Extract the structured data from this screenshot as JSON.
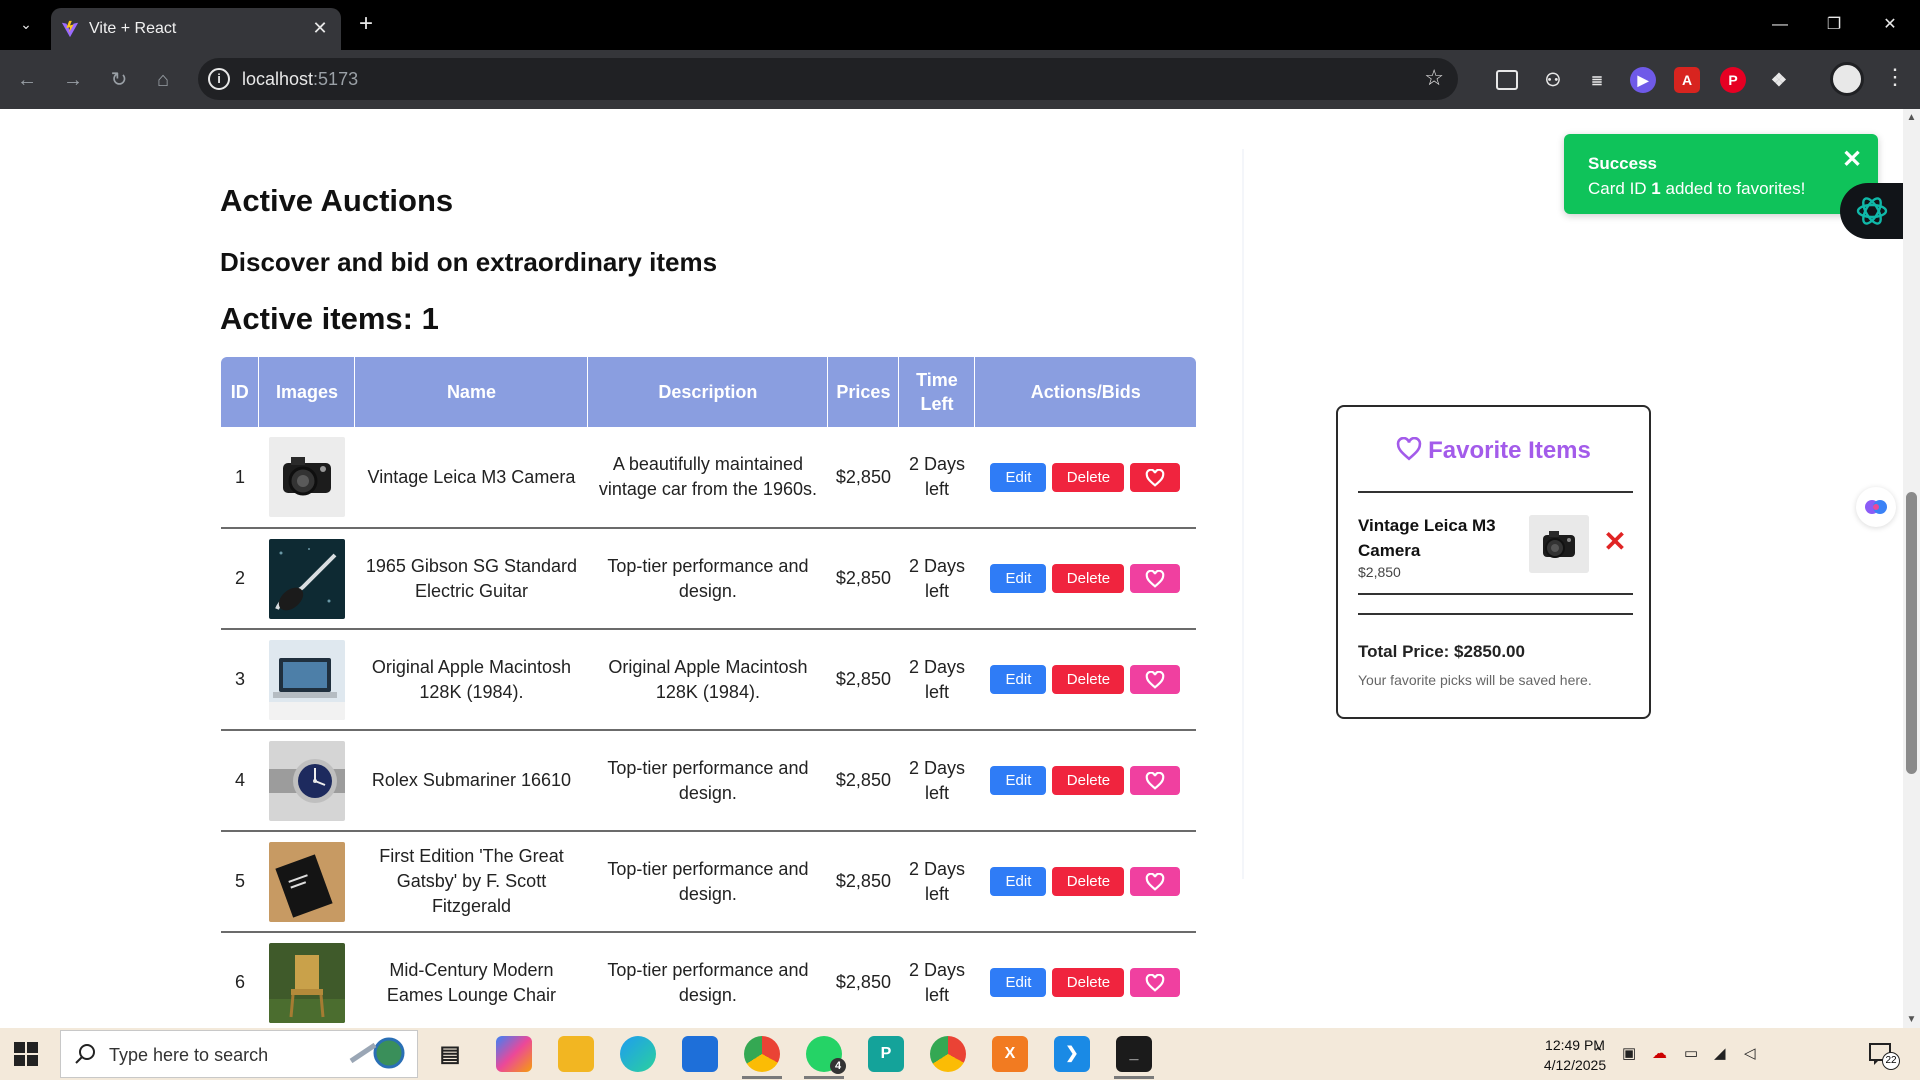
{
  "browser": {
    "tab_title": "Vite + React",
    "url_host": "localhost",
    "url_port": ":5173"
  },
  "page": {
    "title": "Active Auctions",
    "subtitle": "Discover and bid on extraordinary items",
    "active_items": "Active items: 1"
  },
  "table": {
    "headers": [
      "ID",
      "Images",
      "Name",
      "Description",
      "Prices",
      "Time Left",
      "Actions/Bids"
    ],
    "edit_label": "Edit",
    "delete_label": "Delete",
    "rows": [
      {
        "id": "1",
        "image": "camera",
        "name": "Vintage Leica M3 Camera",
        "description": "A beautifully maintained vintage car from the 1960s.",
        "price": "$2,850",
        "time_left": "2 Days left",
        "favorited": true
      },
      {
        "id": "2",
        "image": "guitar",
        "name": "1965 Gibson SG Standard Electric Guitar",
        "description": "Top-tier performance and design.",
        "price": "$2,850",
        "time_left": "2 Days left",
        "favorited": false
      },
      {
        "id": "3",
        "image": "laptop",
        "name": "Original Apple Macintosh 128K (1984).",
        "description": "Original Apple Macintosh 128K (1984).",
        "price": "$2,850",
        "time_left": "2 Days left",
        "favorited": false
      },
      {
        "id": "4",
        "image": "watch",
        "name": "Rolex Submariner 16610",
        "description": "Top-tier performance and design.",
        "price": "$2,850",
        "time_left": "2 Days left",
        "favorited": false
      },
      {
        "id": "5",
        "image": "book",
        "name": "First Edition 'The Great Gatsby' by F. Scott Fitzgerald",
        "description": "Top-tier performance and design.",
        "price": "$2,850",
        "time_left": "2 Days left",
        "favorited": false
      },
      {
        "id": "6",
        "image": "chair",
        "name": "Mid-Century Modern Eames Lounge Chair",
        "description": "Top-tier performance and design.",
        "price": "$2,850",
        "time_left": "2 Days left",
        "favorited": false
      }
    ]
  },
  "favorites": {
    "title": "Favorite Items",
    "items": [
      {
        "name": "Vintage Leica M3 Camera",
        "price": "$2,850",
        "image": "camera"
      }
    ],
    "total": "Total Price: $2850.00",
    "note": "Your favorite picks will be saved here."
  },
  "toast": {
    "title": "Success",
    "message_prefix": "Card ID ",
    "message_id": "1",
    "message_suffix": " added to favorites!"
  },
  "taskbar": {
    "search_placeholder": "Type here to search",
    "time": "12:49 PM",
    "date": "4/12/2025",
    "whatsapp_badge": "4",
    "notification_count": "22"
  },
  "colors": {
    "header_bg": "#8a9ee0",
    "edit": "#2f7cf6",
    "delete": "#f0243e",
    "favorite": "#f040a0",
    "toast": "#0fc35a",
    "favorites_title": "#a35bea"
  }
}
